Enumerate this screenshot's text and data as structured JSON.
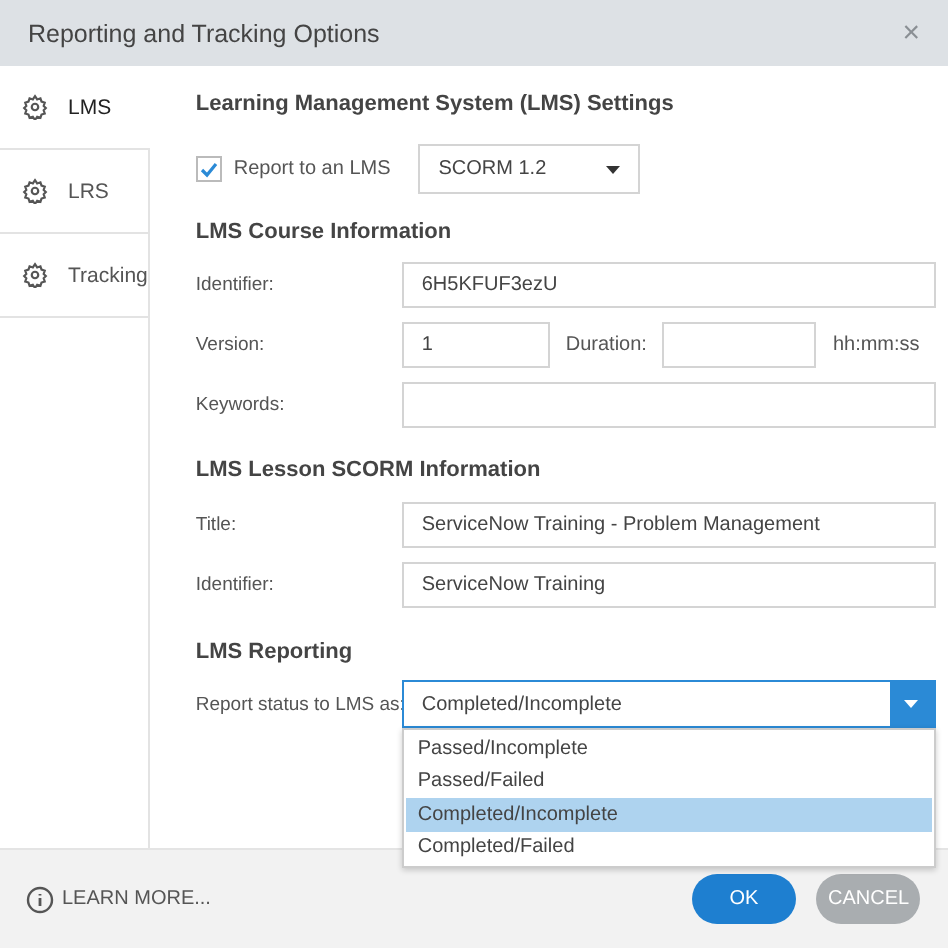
{
  "window": {
    "title": "Reporting and Tracking Options",
    "close": "×"
  },
  "sidebar": {
    "items": [
      {
        "label": "LMS",
        "selected": true
      },
      {
        "label": "LRS",
        "selected": false
      },
      {
        "label": "Tracking",
        "selected": false
      }
    ]
  },
  "lms_settings": {
    "heading": "Learning Management System (LMS) Settings",
    "report_checkbox": {
      "label": "Report to an LMS",
      "checked": true
    },
    "standard": {
      "value": "SCORM 1.2"
    }
  },
  "course_info": {
    "heading": "LMS Course Information",
    "identifier": {
      "label": "Identifier:",
      "value": "6H5KFUF3ezU"
    },
    "version": {
      "label": "Version:",
      "value": "1"
    },
    "duration": {
      "label": "Duration:",
      "unit": "hh:mm:ss"
    },
    "keywords": {
      "label": "Keywords:"
    }
  },
  "lesson_info": {
    "heading": "LMS Lesson SCORM Information",
    "title": {
      "label": "Title:",
      "value": "ServiceNow Training - Problem Management"
    },
    "identifier": {
      "label": "Identifier:",
      "value": "ServiceNow Training"
    }
  },
  "reporting": {
    "heading": "LMS Reporting",
    "status": {
      "label": "Report status to LMS as:",
      "value": "Completed/Incomplete",
      "expanded": true,
      "options": [
        {
          "label": "Passed/Incomplete",
          "selected": false
        },
        {
          "label": "Passed/Failed",
          "selected": false
        },
        {
          "label": "Completed/Incomplete",
          "selected": true
        },
        {
          "label": "Completed/Failed",
          "selected": false
        }
      ]
    }
  },
  "footer": {
    "learn_more": "LEARN MORE...",
    "buttons": [
      {
        "label": "OK",
        "kind": "primary"
      },
      {
        "label": "CANCEL",
        "kind": "secondary"
      }
    ]
  }
}
